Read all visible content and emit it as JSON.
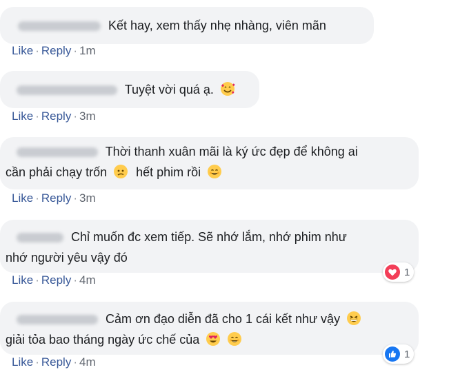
{
  "actions": {
    "like": "Like",
    "reply": "Reply",
    "sep": "·"
  },
  "comments": [
    {
      "text_lines": [
        "Kết hay, xem thấy nhẹ nhàng, viên mãn"
      ],
      "time": "1m"
    },
    {
      "text_lines": [
        "Tuyệt vời quá ạ."
      ],
      "time": "3m",
      "emoji": "smiling-face-with-hearts-icon"
    },
    {
      "text_lines": [
        "Thời thanh xuân mãi là ký ức đẹp để không ai",
        "cần phải chạy trốn",
        "hết phim rồi"
      ],
      "time": "3m"
    },
    {
      "text_lines": [
        "Chỉ muốn đc xem tiếp. Sẽ nhớ lắm, nhớ phim như",
        "nhớ người yêu vậy đó"
      ],
      "time": "4m",
      "reaction": {
        "type": "love",
        "count": "1"
      }
    },
    {
      "text_lines": [
        "Cảm ơn đạo diễn đã cho 1 cái kết như vậy",
        "giải tỏa bao tháng ngày ức chế của"
      ],
      "time": "4m",
      "reaction": {
        "type": "like",
        "count": "1"
      }
    }
  ],
  "colors": {
    "link": "#385898",
    "bubble": "#f2f3f5",
    "love": "#f33e58",
    "like": "#1877f2"
  }
}
